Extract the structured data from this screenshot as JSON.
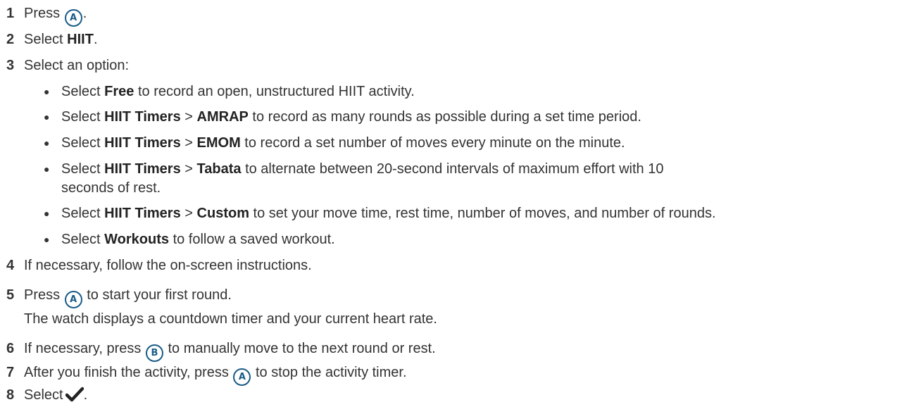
{
  "steps": [
    {
      "num": "1",
      "pre": "Press",
      "button": "A",
      "post": "."
    },
    {
      "num": "2",
      "pre": "Select ",
      "bold": "HIIT",
      "post": "."
    },
    {
      "num": "3",
      "text": "Select an option:"
    },
    {
      "num": "4",
      "text": "If necessary, follow the on-screen instructions."
    },
    {
      "num": "5",
      "pre": "Press",
      "button": "A",
      "post": "to start your first round.",
      "sub": "The watch displays a countdown timer and your current heart rate."
    },
    {
      "num": "6",
      "pre": "If necessary, press",
      "button": "B",
      "post": "to manually move to the next round or rest."
    },
    {
      "num": "7",
      "pre": "After you finish the activity, press",
      "button": "A",
      "post": "to stop the activity timer."
    },
    {
      "num": "8",
      "pre": "Select",
      "icon": "checkmark-icon",
      "post": "."
    }
  ],
  "options": {
    "bullet": "●",
    "separator": ">",
    "select": "Select ",
    "timers": "HIIT Timers",
    "items": [
      {
        "bold": "Free",
        "rest": " to record an open, unstructured HIIT activity."
      },
      {
        "bold2": "AMRAP",
        "rest": " to record as many rounds as possible during a set time period."
      },
      {
        "bold2": "EMOM",
        "rest": " to record a set number of moves every minute on the minute."
      },
      {
        "bold2": "Tabata",
        "rest": " to alternate between 20-second intervals of maximum effort with 10",
        "rest2": "seconds of rest."
      },
      {
        "bold2": "Custom",
        "rest": " to set your move time, rest time, number of moves, and number of rounds."
      },
      {
        "bold": "Workouts",
        "rest": " to follow a saved workout."
      }
    ]
  },
  "colors": {
    "text": "#333333",
    "accent": "#1a5c86"
  }
}
